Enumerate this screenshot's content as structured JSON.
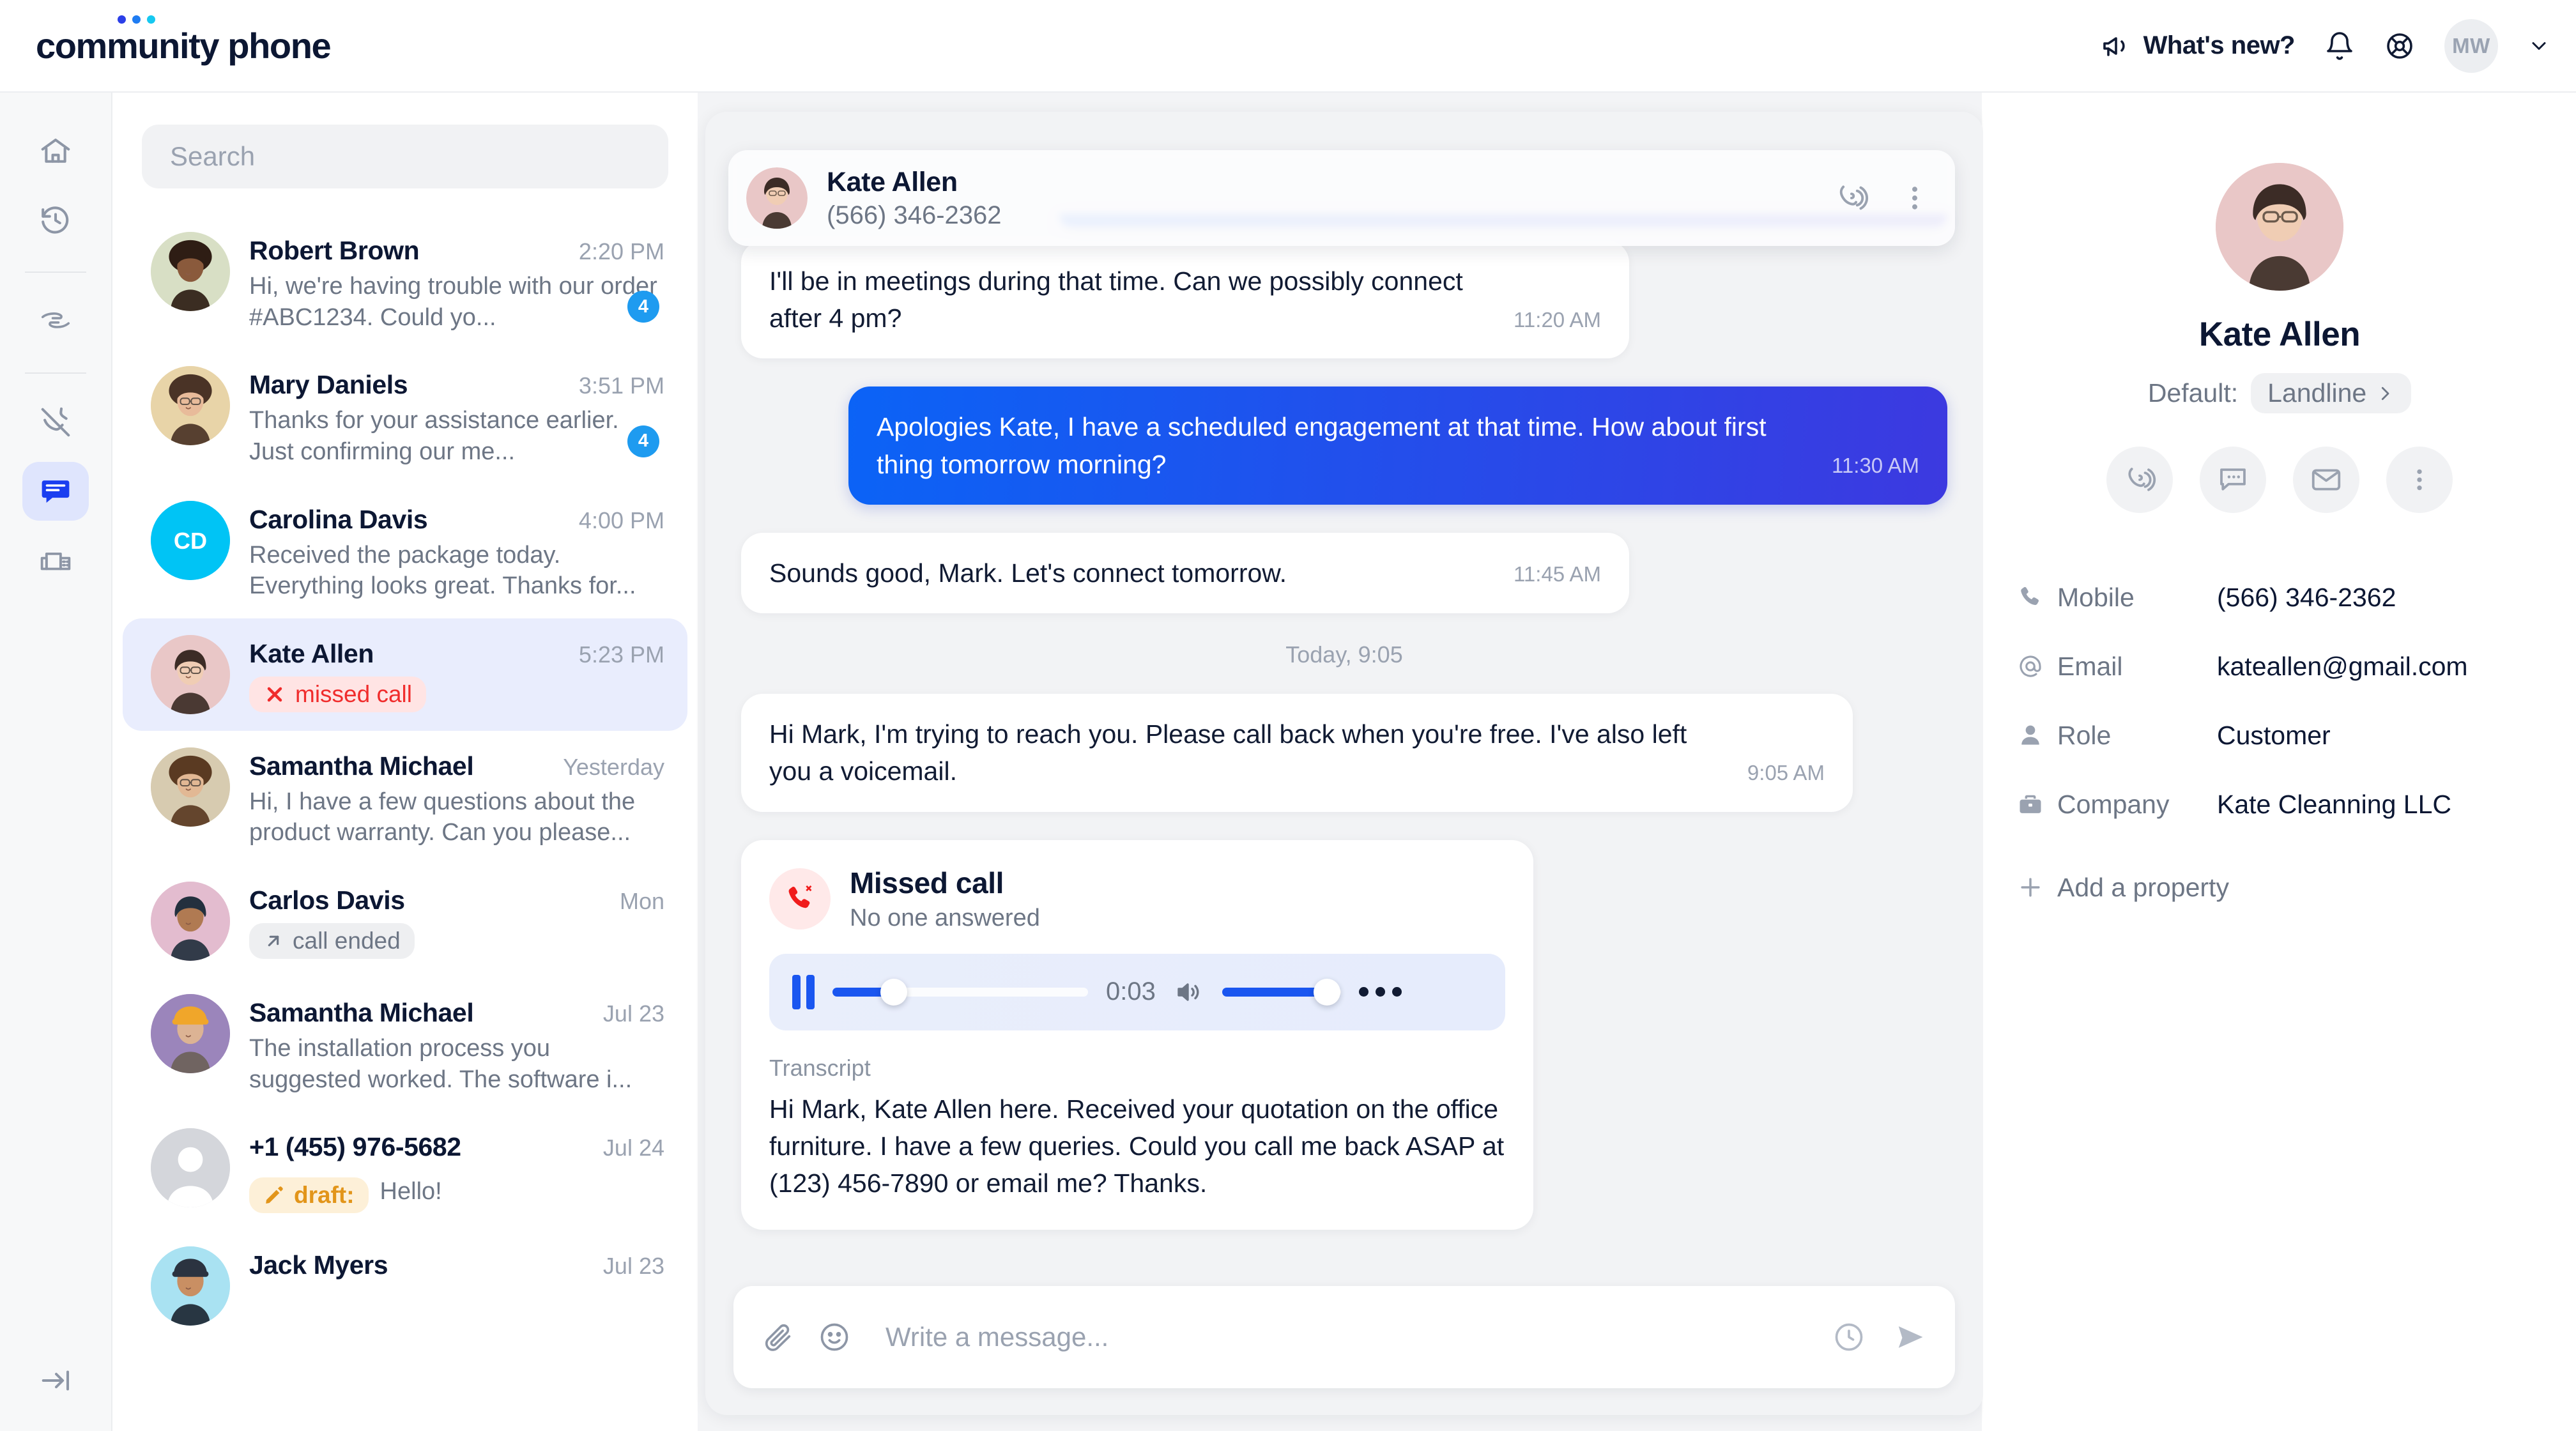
{
  "brand": {
    "logo_word_1": "community",
    "logo_word_2": "phone",
    "dot_colors": [
      "#2b3fe8",
      "#1f7cf2",
      "#16c8f0"
    ],
    "accent_blue": "#1a56f0",
    "badge_blue": "#1e9bf0",
    "missed_red": "#f02c2c",
    "draft_amber": "#e2951a"
  },
  "header": {
    "whats_new_label": "What's new?",
    "megaphone_icon": "megaphone-icon",
    "bell_icon": "bell-icon",
    "help_icon": "lifebuoy-icon",
    "avatar_initials": "MW",
    "chevron_icon": "chevron-down-icon"
  },
  "rail": {
    "items": [
      {
        "icon": "home-icon",
        "name": "home",
        "active": false
      },
      {
        "icon": "history-icon",
        "name": "recents",
        "active": false
      },
      {
        "icon": "hands-icon",
        "name": "contacts",
        "active": false
      },
      {
        "icon": "phone-missed-icon",
        "name": "missed-calls",
        "active": false
      },
      {
        "icon": "message-icon",
        "name": "messages",
        "active": true
      },
      {
        "icon": "fax-icon",
        "name": "fax",
        "active": false
      }
    ],
    "collapse_icon": "expand-panel-icon"
  },
  "search": {
    "placeholder": "Search",
    "value": ""
  },
  "conversations": [
    {
      "name": "Robert Brown",
      "time": "2:20 PM",
      "preview": "Hi, we're having trouble with our order #ABC1234. Could yo...",
      "badge": "4",
      "selected": false,
      "avatar_bg": "#d8dfc5",
      "avatar_type": "photo"
    },
    {
      "name": "Mary Daniels",
      "time": "3:51 PM",
      "preview": "Thanks for your assistance earlier. Just confirming our me...",
      "badge": "4",
      "selected": false,
      "avatar_bg": "#e8d4a8",
      "avatar_type": "photo"
    },
    {
      "name": "Carolina Davis",
      "time": "4:00 PM",
      "preview": "Received the package today. Everything looks great. Thanks for...",
      "badge": "",
      "selected": false,
      "avatar_bg": "#00c4f5",
      "avatar_type": "initials",
      "initials": "CD"
    },
    {
      "name": "Kate Allen",
      "time": "5:23 PM",
      "preview": "",
      "chip": {
        "type": "missed",
        "icon": "x-icon",
        "label": "missed call"
      },
      "badge": "",
      "selected": true,
      "avatar_bg": "#e9c7c7",
      "avatar_type": "photo"
    },
    {
      "name": "Samantha Michael",
      "time": "Yesterday",
      "preview": "Hi, I have a few questions about the product warranty. Can you please...",
      "badge": "",
      "selected": false,
      "avatar_bg": "#d7cbb0",
      "avatar_type": "photo"
    },
    {
      "name": "Carlos Davis",
      "time": "Mon",
      "preview": "",
      "chip": {
        "type": "ended",
        "icon": "arrow-up-right-icon",
        "label": "call ended"
      },
      "badge": "",
      "selected": false,
      "avatar_bg": "#e3bccf",
      "avatar_type": "photo"
    },
    {
      "name": "Samantha Michael",
      "time": "Jul 23",
      "preview": "The installation process you suggested worked. The software i...",
      "badge": "",
      "selected": false,
      "avatar_bg": "#9b85bb",
      "avatar_type": "photo"
    },
    {
      "name": "+1 (455) 976-5682",
      "time": "Jul 24",
      "preview": "",
      "draft": {
        "icon": "pencil-icon",
        "label": "draft:",
        "text": "Hello!"
      },
      "badge": "",
      "selected": false,
      "avatar_bg": "#d4d6db",
      "avatar_type": "placeholder"
    },
    {
      "name": "Jack Myers",
      "time": "Jul 23",
      "preview": "",
      "badge": "",
      "selected": false,
      "avatar_bg": "#a9e2f2",
      "avatar_type": "photo"
    }
  ],
  "chat": {
    "header": {
      "name": "Kate Allen",
      "phone": "(566) 346-2362",
      "call_icon": "phone-ring-icon",
      "more_icon": "more-vertical-icon"
    },
    "messages": [
      {
        "dir": "out",
        "text": "",
        "time": "",
        "cut": true
      },
      {
        "dir": "in",
        "text": "I'll be in meetings during that time. Can we possibly connect after 4 pm?",
        "time": "11:20 AM"
      },
      {
        "dir": "out",
        "text": "Apologies Kate, I have a scheduled engagement at that time. How about first thing tomorrow morning?",
        "time": "11:30 AM"
      },
      {
        "dir": "in",
        "text": "Sounds good, Mark. Let's connect tomorrow.",
        "time": "11:45 AM"
      }
    ],
    "day_divider": "Today, 9:05",
    "last_message": {
      "dir": "in",
      "text": "Hi Mark, I'm trying to reach you. Please call back when you're free. I've also left you a voicemail.",
      "time": "9:05 AM"
    },
    "missed_call_card": {
      "icon": "phone-missed-icon",
      "title": "Missed call",
      "subtitle": "No one answered",
      "player": {
        "state_icon": "pause-icon",
        "elapsed": "0:03",
        "progress_pct": 24,
        "volume_icon": "volume-icon",
        "volume_pct": 88,
        "more_icon": "more-horizontal-icon"
      },
      "transcript_label": "Transcript",
      "transcript": "Hi Mark, Kate Allen here. Received your quotation on the office furniture. I have a few queries. Could you call me back ASAP at (123) 456-7890 or email me? Thanks."
    },
    "composer": {
      "placeholder": "Write a message...",
      "value": "",
      "attach_icon": "paperclip-icon",
      "emoji_icon": "emoji-icon",
      "schedule_icon": "clock-icon",
      "send_icon": "send-icon"
    }
  },
  "contact": {
    "name": "Kate Allen",
    "default_label": "Default:",
    "default_value": "Landline",
    "default_chevron": "chevron-right-icon",
    "actions": [
      {
        "icon": "phone-ring-icon",
        "name": "call"
      },
      {
        "icon": "message-icon",
        "name": "message"
      },
      {
        "icon": "mail-icon",
        "name": "email"
      },
      {
        "icon": "more-vertical-icon",
        "name": "more"
      }
    ],
    "properties": [
      {
        "icon": "phone-icon",
        "label": "Mobile",
        "value": "(566) 346-2362"
      },
      {
        "icon": "at-icon",
        "label": "Email",
        "value": "kateallen@gmail.com"
      },
      {
        "icon": "person-icon",
        "label": "Role",
        "value": "Customer"
      },
      {
        "icon": "briefcase-icon",
        "label": "Company",
        "value": "Kate Cleanning LLC"
      }
    ],
    "add_property_label": "Add a property",
    "add_property_icon": "plus-icon"
  }
}
